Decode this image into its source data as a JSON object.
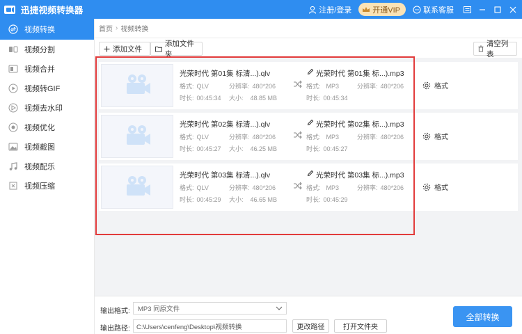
{
  "titlebar": {
    "title": "迅捷视频转换器",
    "register_login": "注册/登录",
    "vip": "开通VIP",
    "service": "联系客服"
  },
  "sidebar": {
    "items": [
      {
        "label": "视频转换",
        "icon": "convert-icon"
      },
      {
        "label": "视频分割",
        "icon": "split-icon"
      },
      {
        "label": "视频合并",
        "icon": "merge-icon"
      },
      {
        "label": "视频转GIF",
        "icon": "gif-icon"
      },
      {
        "label": "视频去水印",
        "icon": "watermark-icon"
      },
      {
        "label": "视频优化",
        "icon": "optimize-icon"
      },
      {
        "label": "视频截图",
        "icon": "screenshot-icon"
      },
      {
        "label": "视频配乐",
        "icon": "music-icon"
      },
      {
        "label": "视频压缩",
        "icon": "compress-icon"
      }
    ]
  },
  "breadcrumb": {
    "home": "首页",
    "current": "视频转换"
  },
  "toolbar": {
    "add_file": "添加文件",
    "add_folder": "添加文件夹",
    "clear_list": "清空列表"
  },
  "labels": {
    "format": "格式:",
    "resolution": "分辨率:",
    "duration": "时长:",
    "size": "大小:",
    "format_button": "格式"
  },
  "files": [
    {
      "src_name": "光荣时代 第01集 标清...).qlv",
      "src_format": "QLV",
      "src_res": "480*206",
      "src_duration": "00:45:34",
      "src_size": "48.85 MB",
      "out_name": "光荣时代 第01集 标...).mp3",
      "out_format": "MP3",
      "out_res": "480*206",
      "out_duration": "00:45:34"
    },
    {
      "src_name": "光荣时代 第02集 标清...).qlv",
      "src_format": "QLV",
      "src_res": "480*206",
      "src_duration": "00:45:27",
      "src_size": "46.25 MB",
      "out_name": "光荣时代 第02集 标...).mp3",
      "out_format": "MP3",
      "out_res": "480*206",
      "out_duration": "00:45:27"
    },
    {
      "src_name": "光荣时代 第03集 标清...).qlv",
      "src_format": "QLV",
      "src_res": "480*206",
      "src_duration": "00:45:29",
      "src_size": "46.65 MB",
      "out_name": "光荣时代 第03集 标...).mp3",
      "out_format": "MP3",
      "out_res": "480*206",
      "out_duration": "00:45:29"
    }
  ],
  "bottom": {
    "output_format_label": "输出格式:",
    "output_format_value": "MP3  同原文件",
    "output_path_label": "输出路径:",
    "output_path_value": "C:\\Users\\cenfeng\\Desktop\\视频转换",
    "change_path": "更改路径",
    "open_folder": "打开文件夹",
    "convert_all": "全部转换"
  },
  "colors": {
    "accent": "#2f8df0",
    "highlight_border": "#e23b3b",
    "vip_bg": "#fbe3b6"
  }
}
